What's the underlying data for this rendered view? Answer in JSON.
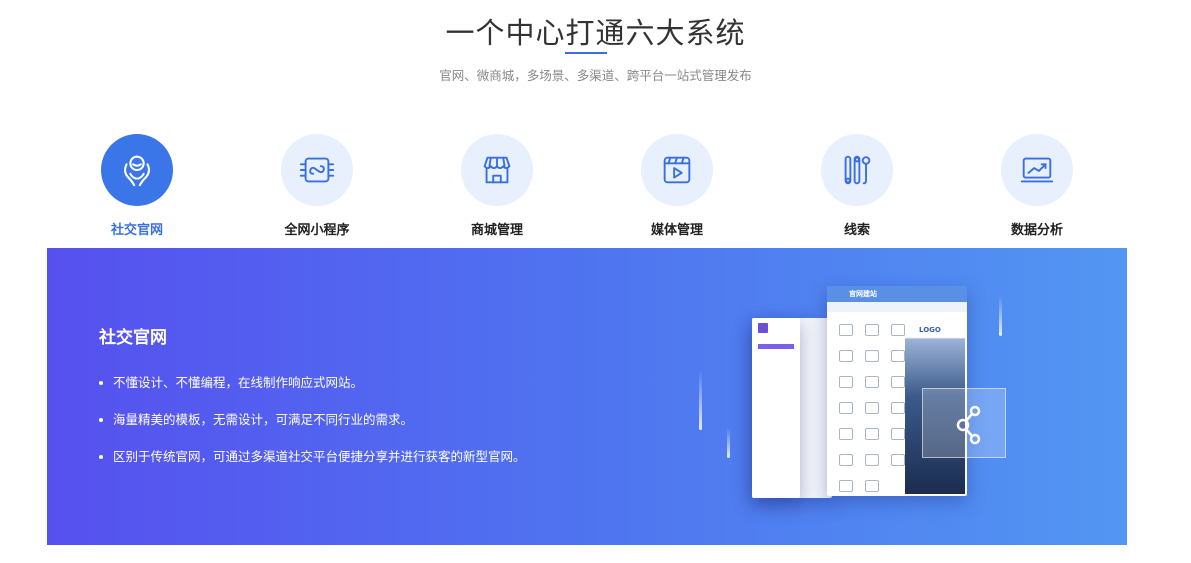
{
  "header": {
    "title": "一个中心打通六大系统",
    "subtitle": "官网、微商城，多场景、多渠道、跨平台一站式管理发布"
  },
  "tabs": [
    {
      "label": "社交官网",
      "icon": "people-hands-icon",
      "active": true
    },
    {
      "label": "全网小程序",
      "icon": "mini-program-icon",
      "active": false
    },
    {
      "label": "商城管理",
      "icon": "storefront-icon",
      "active": false
    },
    {
      "label": "媒体管理",
      "icon": "video-clapper-icon",
      "active": false
    },
    {
      "label": "线索",
      "icon": "sliders-icon",
      "active": false
    },
    {
      "label": "数据分析",
      "icon": "chart-monitor-icon",
      "active": false
    }
  ],
  "panel": {
    "title": "社交官网",
    "bullets": [
      "不懂设计、不懂编程，在线制作响应式网站。",
      "海量精美的模板，无需设计，可满足不同行业的需求。",
      "区别于传统官网，可通过多渠道社交平台便捷分享并进行获客的新型官网。"
    ],
    "illustration": {
      "window_title": "官网建站",
      "logo_text": "LOGO"
    }
  },
  "colors": {
    "accent": "#3a6fe0",
    "panel_gradient_start": "#5650ef",
    "panel_gradient_end": "#5296f2",
    "icon_circle_bg": "#e8effd"
  }
}
